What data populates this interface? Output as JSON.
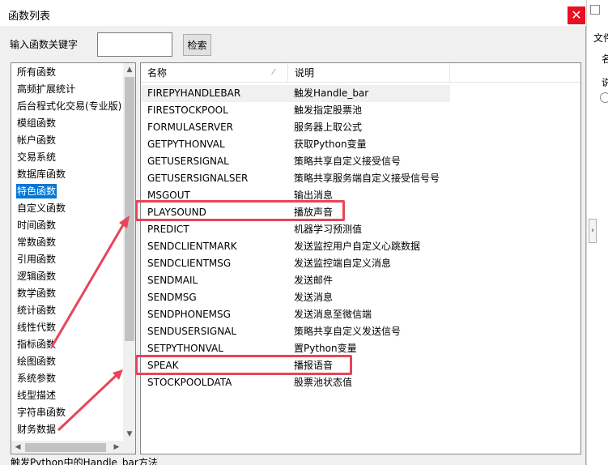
{
  "window": {
    "title": "函数列表",
    "close_glyph": "✕"
  },
  "search": {
    "label": "输入函数关键字",
    "value": "",
    "placeholder": "",
    "button_label": "检索"
  },
  "categories": {
    "selected_index": 7,
    "items": [
      "所有函数",
      "高频扩展统计",
      "后台程式化交易(专业版)",
      "模组函数",
      "帐户函数",
      "交易系统",
      "数据库函数",
      "特色函数",
      "自定义函数",
      "时间函数",
      "常数函数",
      "引用函数",
      "逻辑函数",
      "数学函数",
      "统计函数",
      "线性代数",
      "指标函数",
      "绘图函数",
      "系统参数",
      "线型描述",
      "字符串函数",
      "财务数据"
    ]
  },
  "table": {
    "columns": [
      "名称",
      "说明"
    ],
    "rows": [
      {
        "name": "FIREPYHANDLEBAR",
        "desc": "触发Handle_bar"
      },
      {
        "name": "FIRESTOCKPOOL",
        "desc": "触发指定股票池"
      },
      {
        "name": "FORMULASERVER",
        "desc": "服务器上取公式"
      },
      {
        "name": "GETPYTHONVAL",
        "desc": "获取Python变量"
      },
      {
        "name": "GETUSERSIGNAL",
        "desc": "策略共享自定义接受信号"
      },
      {
        "name": "GETUSERSIGNALSER",
        "desc": "策略共享服务端自定义接受信号号"
      },
      {
        "name": "MSGOUT",
        "desc": "输出消息"
      },
      {
        "name": "PLAYSOUND",
        "desc": "播放声音"
      },
      {
        "name": "PREDICT",
        "desc": "机器学习预测值"
      },
      {
        "name": "SENDCLIENTMARK",
        "desc": "发送监控用户自定义心跳数据"
      },
      {
        "name": "SENDCLIENTMSG",
        "desc": "发送监控端自定义消息"
      },
      {
        "name": "SENDMAIL",
        "desc": "发送邮件"
      },
      {
        "name": "SENDMSG",
        "desc": "发送消息"
      },
      {
        "name": "SENDPHONEMSG",
        "desc": "发送消息至微信端"
      },
      {
        "name": "SENDUSERSIGNAL",
        "desc": "策略共享自定义发送信号"
      },
      {
        "name": "SETPYTHONVAL",
        "desc": "置Python变量"
      },
      {
        "name": "SPEAK",
        "desc": "播报语音"
      },
      {
        "name": "STOCKPOOLDATA",
        "desc": "股票池状态值"
      }
    ]
  },
  "status_text": "触发Python中的Handle_bar方法",
  "background_window": {
    "label1": "文件",
    "label2": "名",
    "label3": "说"
  },
  "colors": {
    "selection": "#0078d7",
    "highlight": "#e8445a",
    "close": "#e81123"
  },
  "icons": {
    "sort": "sort-indicator-icon",
    "close": "close-icon"
  }
}
